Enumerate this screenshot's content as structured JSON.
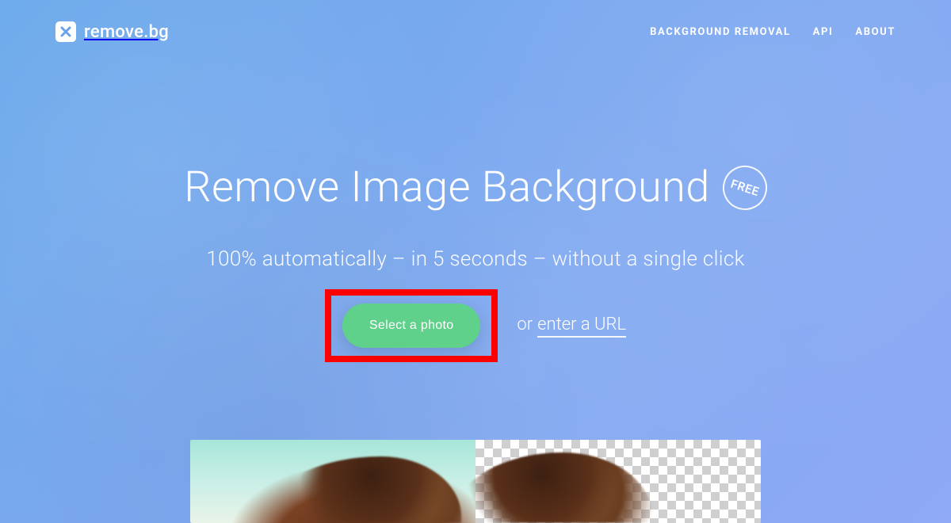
{
  "brand": {
    "name": "remove.bg"
  },
  "nav": {
    "items": [
      {
        "label": "BACKGROUND REMOVAL"
      },
      {
        "label": "API"
      },
      {
        "label": "ABOUT"
      }
    ]
  },
  "hero": {
    "title": "Remove Image Background",
    "free_badge": "FREE",
    "subtitle": "100% automatically – in 5 seconds – without a single click"
  },
  "cta": {
    "select_label": "Select a photo",
    "or_prefix": "or ",
    "url_link_label": "enter a URL"
  }
}
